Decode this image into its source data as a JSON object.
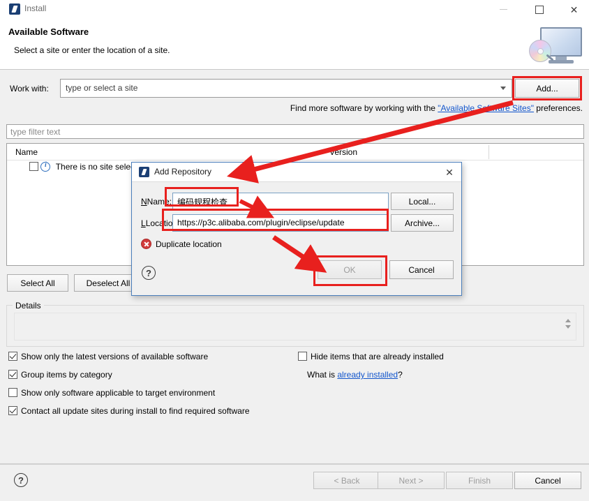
{
  "window": {
    "title": "Install",
    "icon": "eclipse-install-icon",
    "minimize_label": "—",
    "maximize_label": "□",
    "close_label": "✕"
  },
  "header": {
    "title": "Available Software",
    "subtitle": "Select a site or enter the location of a site.",
    "banner_icon": "monitor-with-cd-icon"
  },
  "work_with": {
    "label": "Work with:",
    "value": "",
    "placeholder": "type or select a site",
    "dropdown_icon": "chevron-down-icon",
    "add_button": "Add..."
  },
  "find_more": {
    "prefix": "Find more software by working with the ",
    "link": "\"Available Software Sites\"",
    "suffix": " preferences."
  },
  "filter": {
    "placeholder": "type filter text",
    "value": ""
  },
  "table": {
    "columns": [
      "Name",
      "Version"
    ],
    "rows": [
      {
        "checked": false,
        "icon": "info-icon",
        "name": "There is no site selected.",
        "version": ""
      }
    ]
  },
  "list_buttons": {
    "select_all": "Select All",
    "deselect_all": "Deselect All"
  },
  "details": {
    "legend": "Details",
    "text": "",
    "spinner_icon": "up-down-stepper-icon"
  },
  "options": {
    "left": [
      {
        "label": "Show only the latest versions of available software",
        "checked": true
      },
      {
        "label": "Group items by category",
        "checked": true
      },
      {
        "label": "Show only software applicable to target environment",
        "checked": false
      },
      {
        "label": "Contact all update sites during install to find required software",
        "checked": true
      }
    ],
    "right": [
      {
        "label": "Hide items that are already installed",
        "checked": false
      }
    ],
    "what_is_prefix": "What is ",
    "what_is_link": "already installed",
    "what_is_suffix": "?"
  },
  "footer": {
    "help_icon": "question-mark-icon",
    "help_label": "?",
    "buttons": [
      {
        "label": "< Back",
        "enabled": false
      },
      {
        "label": "Next >",
        "enabled": false
      },
      {
        "label": "Finish",
        "enabled": false
      },
      {
        "label": "Cancel",
        "enabled": true
      }
    ]
  },
  "dialog": {
    "title": "Add Repository",
    "icon": "eclipse-install-icon",
    "close_label": "✕",
    "name_label": "Name:",
    "name_value": "编码规程检查",
    "location_label": "Location:",
    "location_value": "https://p3c.alibaba.com/plugin/eclipse/update",
    "local_button": "Local...",
    "archive_button": "Archive...",
    "error_icon": "error-x-icon",
    "error_text": "Duplicate location",
    "help_icon": "question-mark-icon",
    "help_label": "?",
    "ok_button": "OK",
    "ok_enabled": false,
    "cancel_button": "Cancel",
    "cancel_enabled": true
  },
  "annotations": {
    "color": "#e8201e",
    "highlight_boxes": [
      "add-button",
      "name-field-value",
      "location-field",
      "ok-button"
    ],
    "arrows": [
      {
        "from": "add-button",
        "to": "dialog-title"
      },
      {
        "from": "name-field",
        "to": "location-field"
      },
      {
        "from": "location-field",
        "to": "ok-button"
      }
    ]
  }
}
